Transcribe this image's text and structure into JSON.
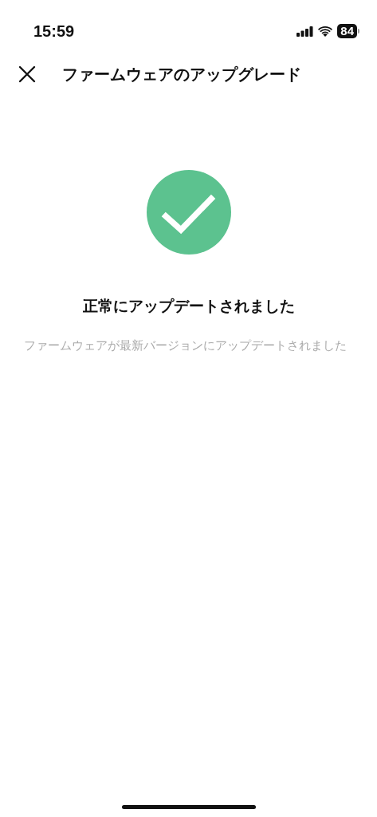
{
  "status_bar": {
    "time": "15:59",
    "battery": "84"
  },
  "header": {
    "title": "ファームウェアのアップグレード"
  },
  "result": {
    "kind": "success",
    "title": "正常にアップデートされました",
    "message": "ファームウェアが最新バージョンにアップデートされました"
  }
}
